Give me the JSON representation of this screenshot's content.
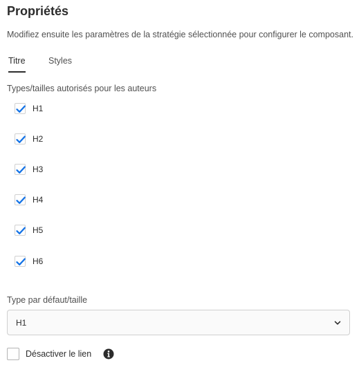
{
  "panel": {
    "title": "Propriétés",
    "description": "Modifiez ensuite les paramètres de la stratégie sélectionnée pour configurer le composant."
  },
  "tabs": [
    {
      "label": "Titre",
      "selected": true
    },
    {
      "label": "Styles",
      "selected": false
    }
  ],
  "allowed_types": {
    "label": "Types/tailles autorisés pour les auteurs",
    "options": [
      {
        "label": "H1",
        "checked": true
      },
      {
        "label": "H2",
        "checked": true
      },
      {
        "label": "H3",
        "checked": true
      },
      {
        "label": "H4",
        "checked": true
      },
      {
        "label": "H5",
        "checked": true
      },
      {
        "label": "H6",
        "checked": true
      }
    ]
  },
  "default_type": {
    "label": "Type par défaut/taille",
    "value": "H1"
  },
  "disable_link": {
    "label": "Désactiver le lien",
    "checked": false
  },
  "icons": {
    "checkmark": "checkmark-icon",
    "chevron": "chevron-down-icon",
    "info": "info-icon"
  },
  "colors": {
    "accent": "#1473e6",
    "text": "#2c2c2c",
    "muted_text": "#505050",
    "border": "#cfcfcf"
  }
}
